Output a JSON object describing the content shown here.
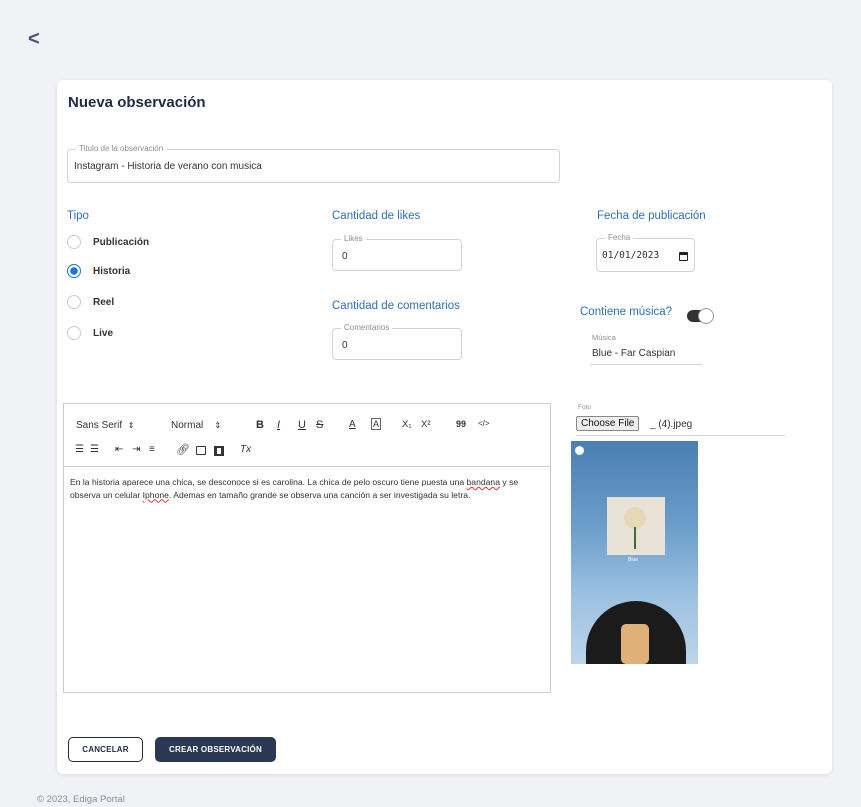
{
  "nav": {
    "back_label": "<"
  },
  "form": {
    "title": "Nueva observación",
    "titulo_field": {
      "legend": "Titulo de la observación",
      "value": "Instagram - Historia de verano con musica"
    },
    "tipo": {
      "label": "Tipo",
      "options": [
        {
          "label": "Publicación",
          "checked": false
        },
        {
          "label": "Historia",
          "checked": true
        },
        {
          "label": "Reel",
          "checked": false
        },
        {
          "label": "Live",
          "checked": false
        }
      ]
    },
    "likes": {
      "section_label": "Cantidad de likes",
      "legend": "Likes",
      "value": "0"
    },
    "comentarios": {
      "section_label": "Cantidad de comentarios",
      "legend": "Comentarios",
      "value": "0"
    },
    "fecha": {
      "section_label": "Fecha de publicación",
      "legend": "Fecha",
      "value": "01/01/2023"
    },
    "musica": {
      "toggle_label": "Contiene música?",
      "toggle_on": true,
      "legend": "Música",
      "value": "Blue - Far Caspian"
    }
  },
  "editor": {
    "toolbar": {
      "font": "Sans Serif",
      "size": "Normal",
      "bold": "B",
      "italic": "I",
      "underline": "U",
      "strike": "S",
      "color": "A",
      "background": "A",
      "subscript": "X₁",
      "superscript": "X²",
      "quote": "99",
      "code": "</>",
      "clean": "Tx"
    },
    "text_parts": [
      "En la historia aparece una chica, se desconoce si es carolina. La chica de pelo oscuro tiene puesta una ",
      "bandana",
      " y se observa un celular ",
      "Iphone",
      ". Ademas en tamaño grande se observa una canción a ser investigada su letra."
    ]
  },
  "foto": {
    "label": "Foto",
    "choose_button": "Choose File",
    "file_name": "_ (4).jpeg",
    "story_overlay_text": "Blue"
  },
  "buttons": {
    "cancel": "CANCELAR",
    "create": "CREAR OBSERVACIÓN"
  },
  "footer": {
    "copyright": "© 2023, Ediga Portal"
  },
  "colors": {
    "accent": "#1976d2",
    "section_label": "#2f6fb6",
    "primary_button": "#2a3856",
    "background": "#f1f2f5"
  }
}
